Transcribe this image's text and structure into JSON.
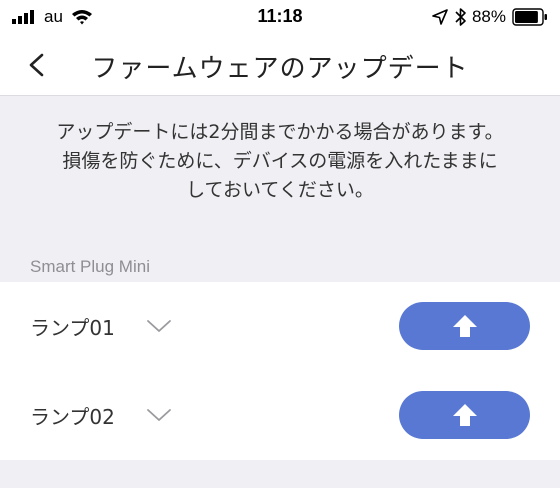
{
  "status_bar": {
    "carrier": "au",
    "time": "11:18",
    "battery_percent": "88%",
    "battery_level": 0.88
  },
  "nav": {
    "title": "ファームウェアのアップデート"
  },
  "notice": {
    "lines": [
      "アップデートには2分間までかかる場合があります。",
      "損傷を防ぐために、デバイスの電源を入れたままに",
      "しておいてください。"
    ]
  },
  "section": {
    "title": "Smart Plug Mini"
  },
  "devices": [
    {
      "name": "ランプ01"
    },
    {
      "name": "ランプ02"
    }
  ],
  "colors": {
    "accent": "#5878d3",
    "background": "#efeff4"
  }
}
